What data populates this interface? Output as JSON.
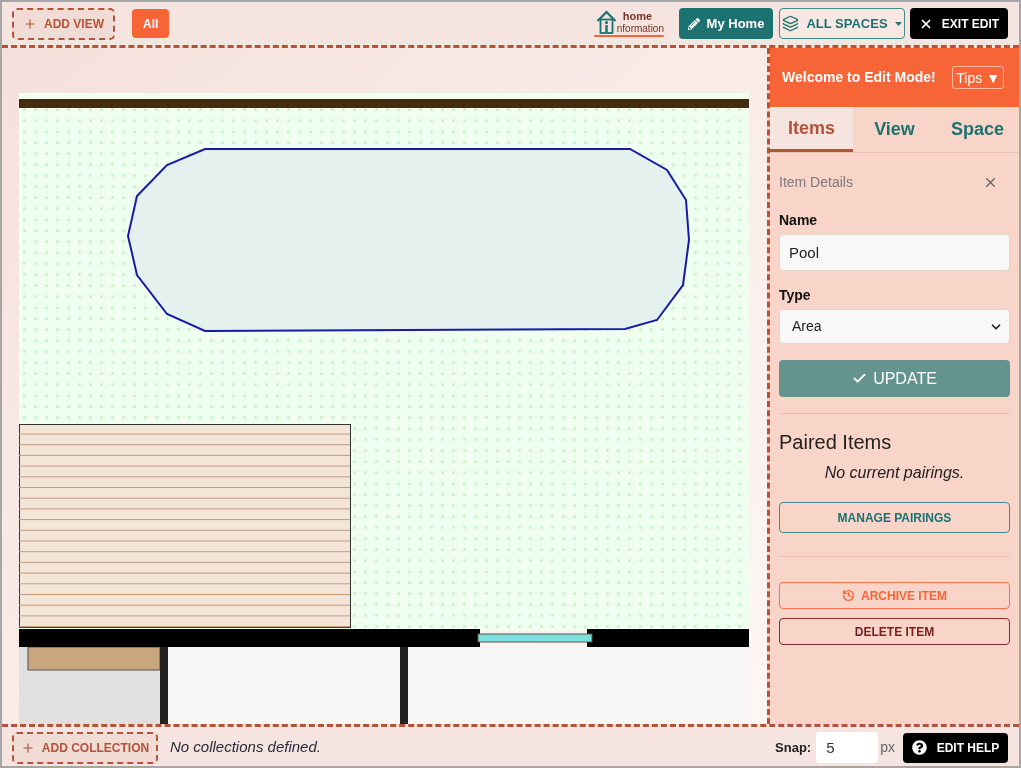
{
  "toolbar": {
    "add_view": "ADD VIEW",
    "views": [
      {
        "label": "All",
        "selected": true
      }
    ],
    "logo": {
      "line_1": "home",
      "line_2": "nformation"
    },
    "my_home": "My Home",
    "spaces": "ALL SPACES",
    "exit_edit": "EXIT EDIT"
  },
  "edit_panel": {
    "title": "Welcome to Edit Mode!",
    "tips": "Tips ▼",
    "tabs": [
      {
        "label": "Items",
        "selected": true
      },
      {
        "label": "View",
        "selected": false
      },
      {
        "label": "Space",
        "selected": false
      }
    ],
    "item_details": {
      "heading": "Item Details",
      "name_label": "Name",
      "name_value": "Pool",
      "type_label": "Type",
      "type_value": "Area",
      "update": "UPDATE"
    },
    "paired_items": {
      "heading": "Paired Items",
      "empty": "No current pairings.",
      "manage": "MANAGE PAIRINGS"
    },
    "archive": "ARCHIVE ITEM",
    "delete": "DELETE ITEM"
  },
  "status_bar": {
    "add_collection": "ADD COLLECTION",
    "collections_empty": "No collections defined.",
    "snap_label": "Snap:",
    "snap_value": "5",
    "snap_unit": "px",
    "edit_help": "EDIT HELP"
  }
}
